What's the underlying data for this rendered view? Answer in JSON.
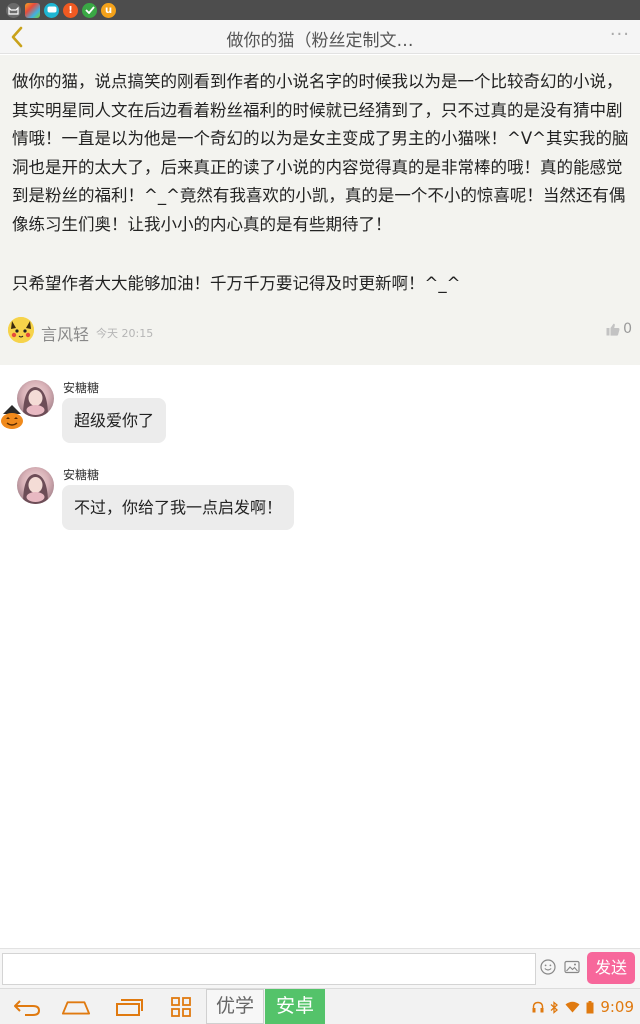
{
  "header": {
    "title": "做你的猫（粉丝定制文…",
    "more": "···"
  },
  "post": {
    "paragraphs": [
      "做你的猫，说点搞笑的刚看到作者的小说名字的时候我以为是一个比较奇幻的小说，其实明星同人文在后边看着粉丝福利的时候就已经猜到了，只不过真的是没有猜中剧情哦！一直是以为他是一个奇幻的以为是女主变成了男主的小猫咪！^V^其实我的脑洞也是开的太大了，后来真正的读了小说的内容觉得真的是非常棒的哦！真的能感觉到是粉丝的福利！^_^竟然有我喜欢的小凯，真的是一个不小的惊喜呢！当然还有偶像练习生们奥！让我小小的内心真的是有些期待了！",
      "只希望作者大大能够加油！千万千万要记得及时更新啊！^_^"
    ],
    "author": "言风轻",
    "time": "今天 20:15",
    "likes": "0"
  },
  "comments": [
    {
      "name": "安糖糖",
      "text": "超级爱你了"
    },
    {
      "name": "安糖糖",
      "text": "不过，你给了我一点启发啊！"
    }
  ],
  "input": {
    "value": "",
    "placeholder": "",
    "send_label": "发送"
  },
  "navbar": {
    "tag_youxue": "优学",
    "tag_anzhuo": "安卓",
    "clock": "9:09"
  },
  "colors": {
    "accent_pink": "#f7679b",
    "anzhuo_green": "#54c36a",
    "back_arrow": "#c9a21b",
    "nav_orange": "#e07a10"
  },
  "icons": {
    "status_bar": [
      "cat-app-icon",
      "photos-app-icon",
      "chat-app-icon",
      "alert-app-icon",
      "check-app-icon",
      "u-app-icon"
    ],
    "header": [
      "back-arrow-icon",
      "more-icon"
    ],
    "input_bar": [
      "emoji-icon",
      "image-icon"
    ],
    "nav": [
      "back-icon",
      "home-icon",
      "recent-apps-icon",
      "grid-icon"
    ],
    "tray": [
      "headphones-icon",
      "bluetooth-icon",
      "wifi-icon",
      "battery-icon"
    ]
  }
}
